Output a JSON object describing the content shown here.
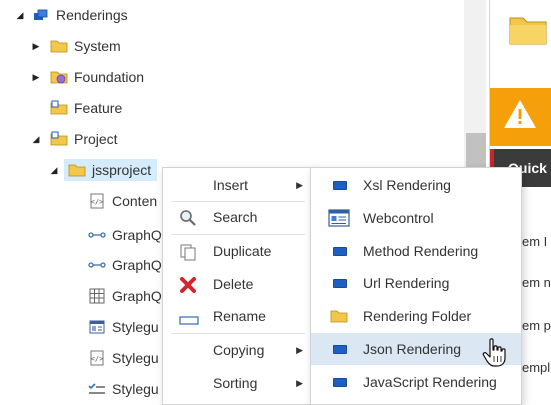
{
  "tree": {
    "items": [
      {
        "label": "Renderings",
        "icon": "renderings-icon"
      },
      {
        "label": "System",
        "icon": "folder-icon"
      },
      {
        "label": "Foundation",
        "icon": "foundation-folder-icon"
      },
      {
        "label": "Feature",
        "icon": "feature-folder-icon"
      },
      {
        "label": "Project",
        "icon": "project-folder-icon"
      },
      {
        "label": "jssproject",
        "icon": "folder-icon"
      },
      {
        "label": "Conten",
        "icon": "code-file-icon"
      },
      {
        "label": "GraphQ",
        "icon": "graphql-icon"
      },
      {
        "label": "GraphQ",
        "icon": "graphql-icon"
      },
      {
        "label": "GraphQ",
        "icon": "grid-icon"
      },
      {
        "label": "Stylegu",
        "icon": "layout-icon"
      },
      {
        "label": "Stylegu",
        "icon": "code-file-icon"
      },
      {
        "label": "Stylegu",
        "icon": "checklist-icon"
      }
    ]
  },
  "context_menu": {
    "items": [
      {
        "label": "Insert",
        "submenu": true
      },
      {
        "label": "Search",
        "icon": "search-icon"
      },
      {
        "label": "Duplicate",
        "icon": "duplicate-icon"
      },
      {
        "label": "Delete",
        "icon": "delete-icon"
      },
      {
        "label": "Rename",
        "icon": "rename-icon"
      },
      {
        "label": "Copying",
        "submenu": true
      },
      {
        "label": "Sorting",
        "submenu": true
      }
    ]
  },
  "insert_menu": {
    "items": [
      {
        "label": "Xsl Rendering",
        "icon": "rendering-icon"
      },
      {
        "label": "Webcontrol",
        "icon": "webcontrol-icon"
      },
      {
        "label": "Method Rendering",
        "icon": "rendering-icon"
      },
      {
        "label": "Url Rendering",
        "icon": "rendering-icon"
      },
      {
        "label": "Rendering Folder",
        "icon": "folder-icon"
      },
      {
        "label": "Json Rendering",
        "icon": "rendering-icon",
        "hovered": true
      },
      {
        "label": "JavaScript Rendering",
        "icon": "rendering-icon"
      }
    ]
  },
  "right_panel": {
    "quick_label": "Quick",
    "fragments": [
      "em I",
      "em n",
      "em p",
      "empl"
    ]
  },
  "colors": {
    "accent_orange": "#f5a00a",
    "dark_bar": "#3b3b3b",
    "red_strip": "#c8252c",
    "selection": "#d4ecfb",
    "hover": "#dbe7f3"
  }
}
